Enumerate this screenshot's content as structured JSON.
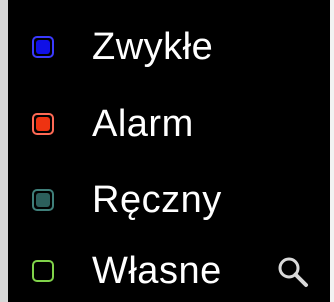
{
  "legend": {
    "items": [
      {
        "label": "Zwykłe",
        "border": "#3a3aff",
        "fill": "#1010e6"
      },
      {
        "label": "Alarm",
        "border": "#ff6a55",
        "fill": "#ee3311"
      },
      {
        "label": "Ręczny",
        "border": "#3f7f7a",
        "fill": "#2c5f5c"
      },
      {
        "label": "Własne",
        "border": "#80d24a",
        "fill": "#000000"
      }
    ],
    "search_icon": "search-icon"
  }
}
